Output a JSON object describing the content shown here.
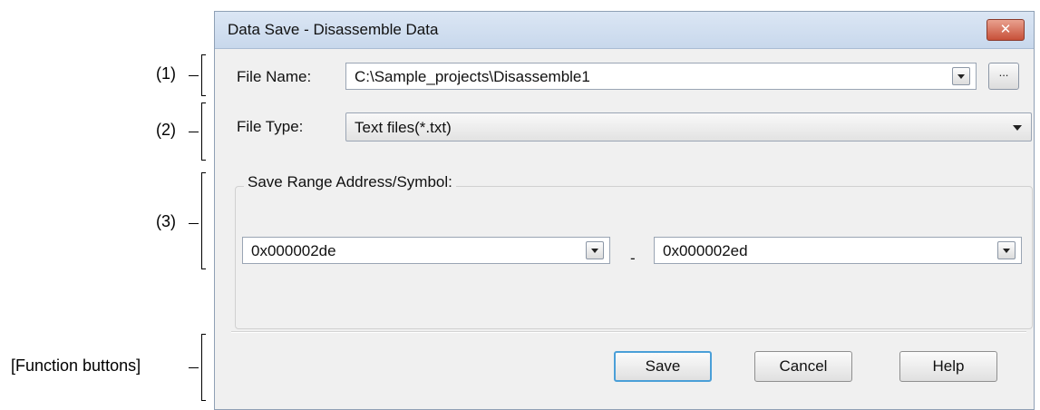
{
  "callouts": {
    "c1": "(1)",
    "c2": "(2)",
    "c3": "(3)",
    "c4": "[Function buttons]"
  },
  "dialog": {
    "title": "Data Save - Disassemble Data",
    "close_glyph": "✕",
    "file_name_label": "File Name:",
    "file_name_value": "C:\\Sample_projects\\Disassemble1",
    "browse_label": "...",
    "file_type_label": "File Type:",
    "file_type_value": "Text files(*.txt)",
    "range_group_label": "Save Range Address/Symbol:",
    "range_start": "0x000002de",
    "range_separator": "-",
    "range_end": "0x000002ed",
    "buttons": {
      "save": "Save",
      "cancel": "Cancel",
      "help": "Help"
    }
  },
  "colors": {
    "close_button": "#c75039",
    "default_button_border": "#4a9fd8",
    "title_bar": "#dbe6f4"
  }
}
